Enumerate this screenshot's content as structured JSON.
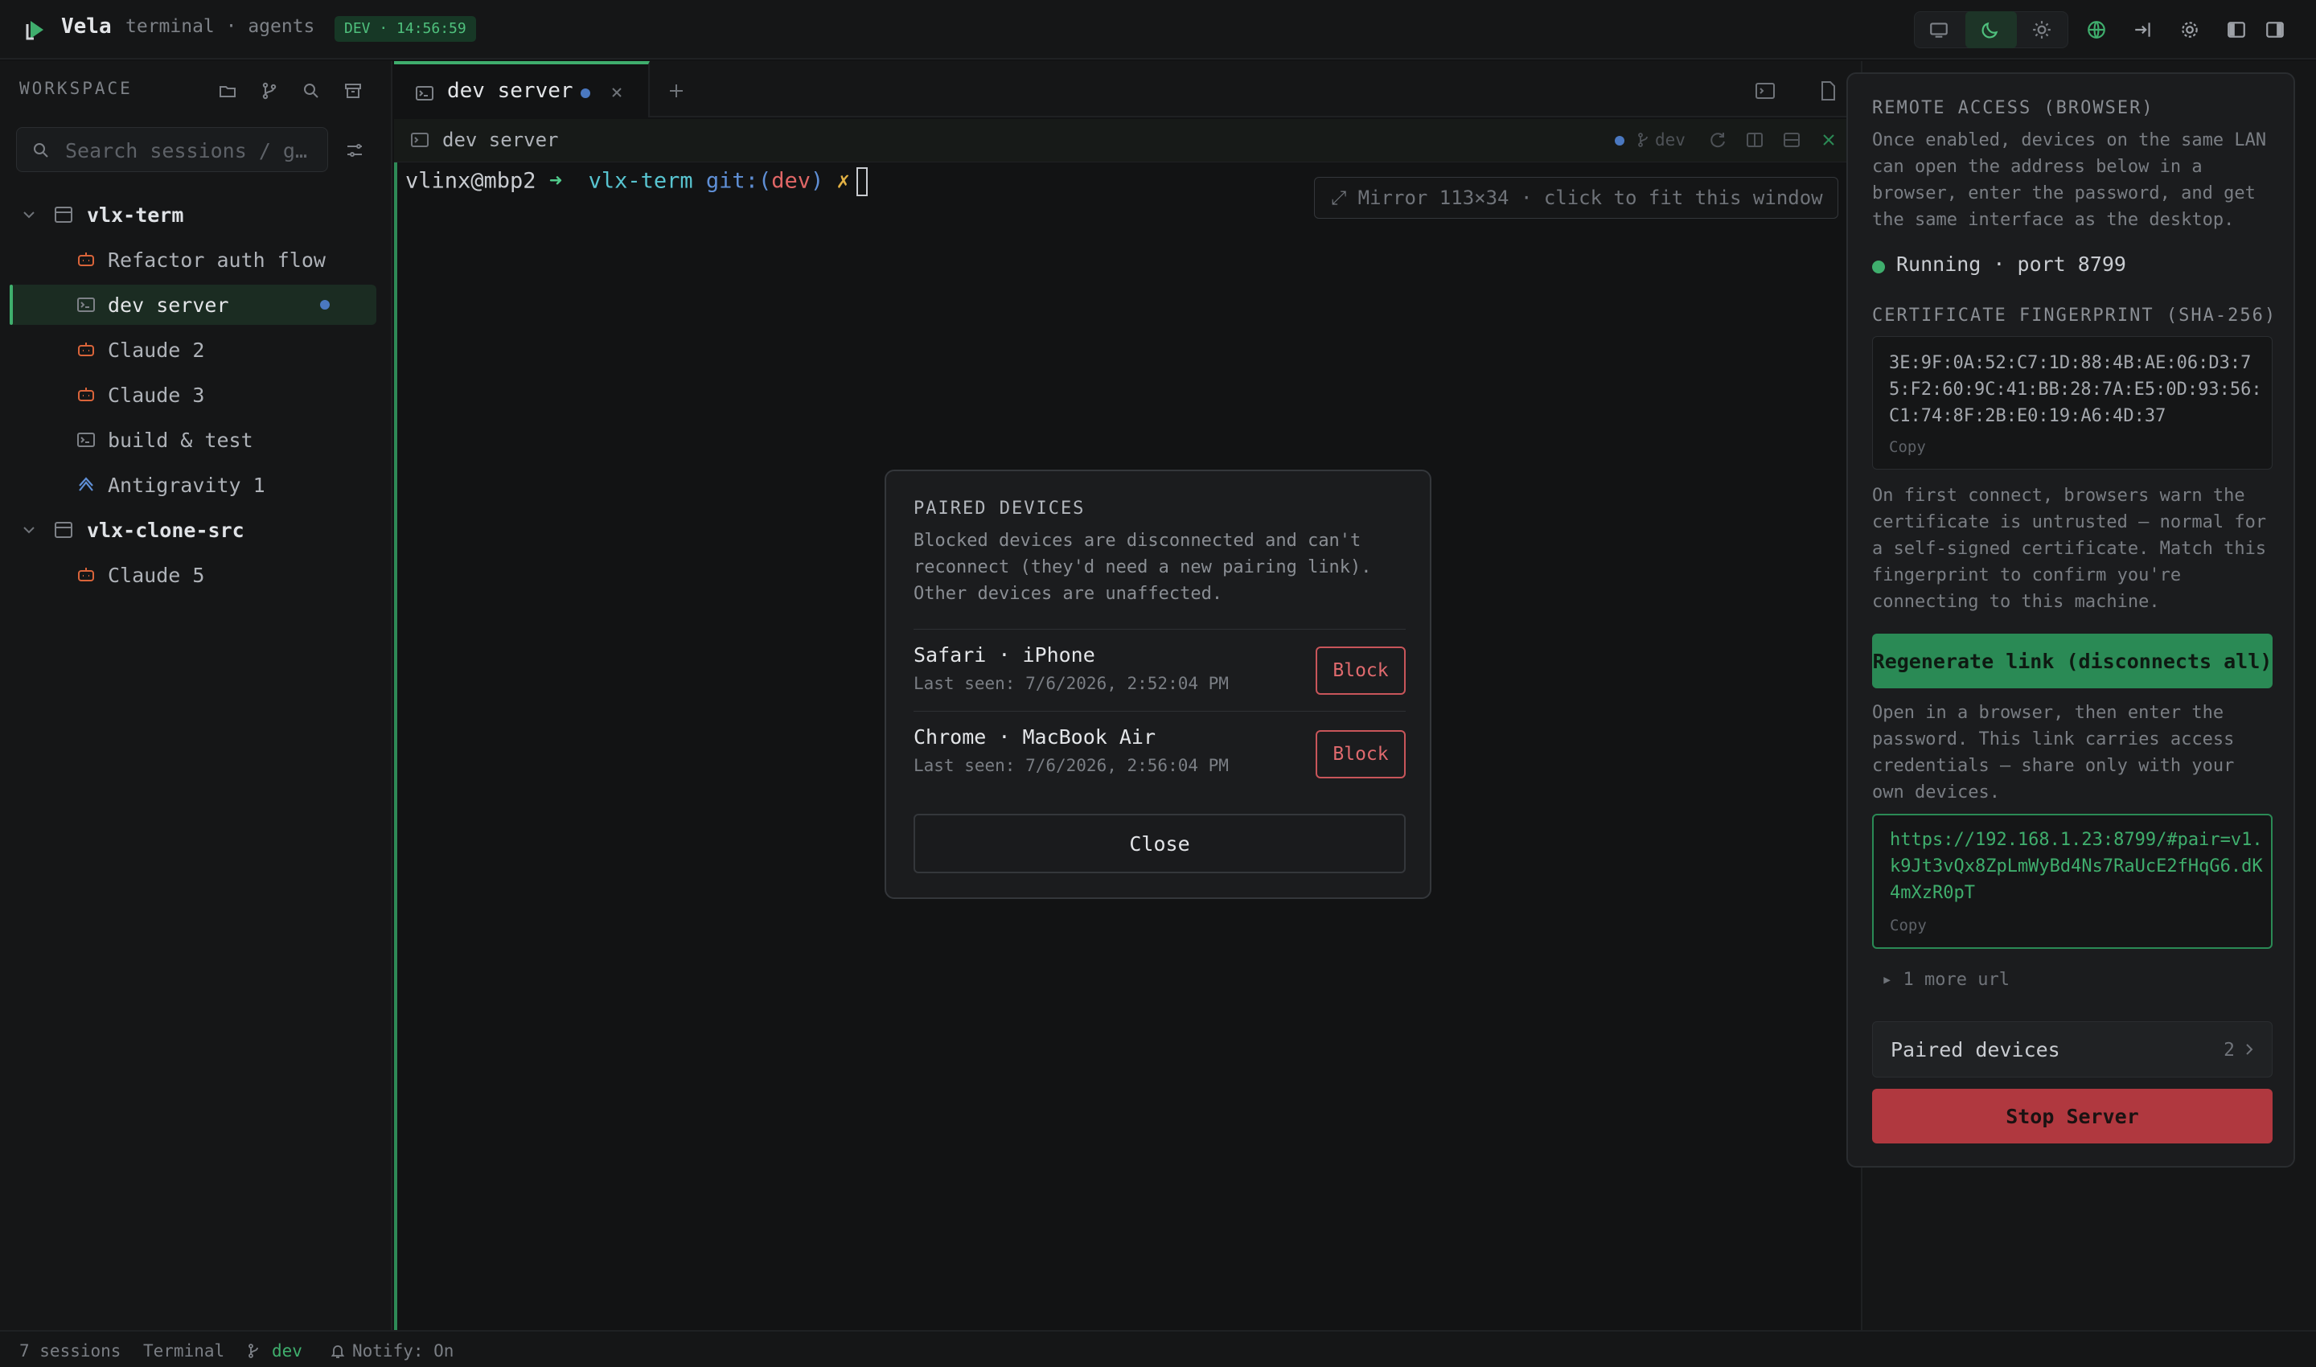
{
  "titlebar": {
    "app_name": "Vela",
    "subtitle": "terminal · agents",
    "dev_badge": "DEV · 14:56:59"
  },
  "sidebar": {
    "section_label": "WORKSPACE",
    "search_placeholder": "Search sessions / g…",
    "groups": [
      {
        "label": "vlx-term",
        "items": [
          {
            "label": "Refactor auth flow",
            "icon": "robot-icon"
          },
          {
            "label": "dev server",
            "icon": "terminal-icon",
            "active": true
          },
          {
            "label": "Claude 2",
            "icon": "robot-icon"
          },
          {
            "label": "Claude 3",
            "icon": "robot-icon"
          },
          {
            "label": "build & test",
            "icon": "terminal-icon"
          },
          {
            "label": "Antigravity 1",
            "icon": "antigravity-icon"
          }
        ]
      },
      {
        "label": "vlx-clone-src",
        "items": [
          {
            "label": "Claude 5",
            "icon": "robot-icon"
          }
        ]
      }
    ]
  },
  "tabs": [
    {
      "label": "dev server"
    }
  ],
  "terminal": {
    "header_label": "dev server",
    "branch_chip": "dev",
    "prompt_user": "vlinx@mbp2",
    "prompt_arrow": "➜",
    "prompt_dir": "vlx-term",
    "prompt_git": "git:(",
    "prompt_branch": "dev",
    "prompt_git_close": ")",
    "prompt_x": "✗",
    "mirror_text": "⤢ Mirror 113×34 · click to fit this window"
  },
  "remote": {
    "title": "REMOTE ACCESS (BROWSER)",
    "intro": "Once enabled, devices on the same LAN can open the address below in a browser, enter the password, and get the same interface as the desktop.",
    "status": "Running · port 8799",
    "fp_title": "CERTIFICATE FINGERPRINT (SHA-256)",
    "fingerprint": "3E:9F:0A:52:C7:1D:88:4B:AE:06:D3:75:F2:60:9C:41:BB:28:7A:E5:0D:93:56:C1:74:8F:2B:E0:19:A6:4D:37",
    "copy_label": "Copy",
    "fp_note": "On first connect, browsers warn the certificate is untrusted — normal for a self-signed certificate. Match this fingerprint to confirm you're connecting to this machine.",
    "regen_label": "Regenerate link (disconnects all)",
    "url_note": "Open in a browser, then enter the password. This link carries access credentials — share only with your own devices.",
    "url": "https://192.168.1.23:8799/#pair=v1.k9Jt3vQx8ZpLmWyBd4Ns7RaUcE2fHqG6.dK4mXzR0pT",
    "more_url": "▸ 1 more url",
    "paired_label": "Paired devices",
    "paired_count": "2",
    "stop_label": "Stop Server"
  },
  "modal": {
    "title": "PAIRED DEVICES",
    "description": "Blocked devices are disconnected and can't reconnect (they'd need a new pairing link). Other devices are unaffected.",
    "devices": [
      {
        "name": "Safari · iPhone",
        "last_seen": "Last seen: 7/6/2026, 2:52:04 PM",
        "action": "Block"
      },
      {
        "name": "Chrome · MacBook Air",
        "last_seen": "Last seen: 7/6/2026, 2:56:04 PM",
        "action": "Block"
      }
    ],
    "close_label": "Close"
  },
  "statusbar": {
    "sessions": "7 sessions",
    "mode": "Terminal",
    "branch": "dev",
    "notify": "Notify: On"
  },
  "colors": {
    "accent": "#3fae6d",
    "danger": "#b0383f",
    "background": "#121314"
  }
}
